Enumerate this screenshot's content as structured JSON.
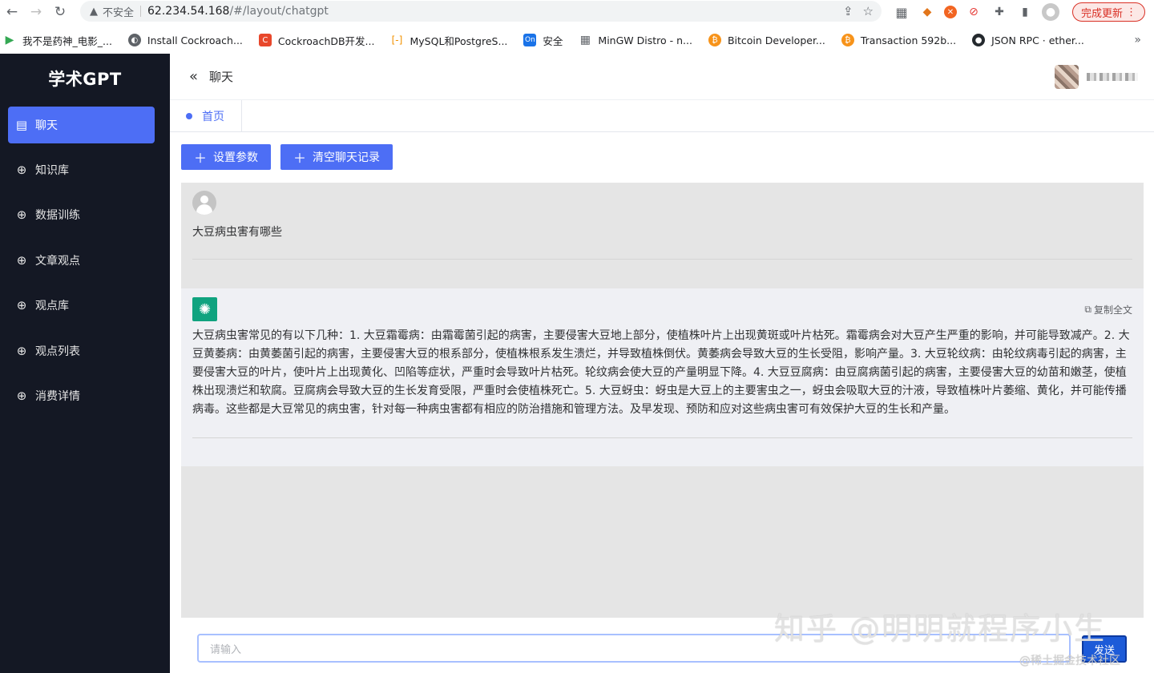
{
  "browser": {
    "insecure_label": "不安全",
    "url_host": "62.234.54.168",
    "url_path": "/#/layout/chatgpt",
    "update_label": "完成更新",
    "bookmarks": [
      "我不是药神_电影_...",
      "Install Cockroach...",
      "CockroachDB开发...",
      "MySQL和PostgreS...",
      "安全",
      "MinGW Distro - n...",
      "Bitcoin Developer...",
      "Transaction 592b...",
      "JSON RPC · ether..."
    ],
    "more_label": "»"
  },
  "sidebar": {
    "logo": "学术GPT",
    "items": [
      {
        "label": "聊天",
        "active": true
      },
      {
        "label": "知识库"
      },
      {
        "label": "数据训练"
      },
      {
        "label": "文章观点"
      },
      {
        "label": "观点库"
      },
      {
        "label": "观点列表"
      },
      {
        "label": "消费详情"
      }
    ]
  },
  "header": {
    "title": "聊天"
  },
  "tabs": [
    {
      "label": "首页"
    }
  ],
  "toolbar": {
    "set_params_label": "设置参数",
    "clear_history_label": "清空聊天记录"
  },
  "chat": {
    "user_message": "大豆病虫害有哪些",
    "copy_label": "复制全文",
    "ai_message": "大豆病虫害常见的有以下几种：1. 大豆霜霉病：由霜霉菌引起的病害，主要侵害大豆地上部分，使植株叶片上出现黄斑或叶片枯死。霜霉病会对大豆产生严重的影响，并可能导致减产。2. 大豆黄萎病：由黄萎菌引起的病害，主要侵害大豆的根系部分，使植株根系发生溃烂，并导致植株倒伏。黄萎病会导致大豆的生长受阻，影响产量。3. 大豆轮纹病：由轮纹病毒引起的病害，主要侵害大豆的叶片，使叶片上出现黄化、凹陷等症状，严重时会导致叶片枯死。轮纹病会使大豆的产量明显下降。4. 大豆豆腐病：由豆腐病菌引起的病害，主要侵害大豆的幼苗和嫩茎，使植株出现溃烂和软腐。豆腐病会导致大豆的生长发育受限，严重时会使植株死亡。5. 大豆蚜虫：蚜虫是大豆上的主要害虫之一，蚜虫会吸取大豆的汁液，导致植株叶片萎缩、黄化，并可能传播病毒。这些都是大豆常见的病虫害，针对每一种病虫害都有相应的防治措施和管理方法。及早发现、预防和应对这些病虫害可有效保护大豆的生长和产量。"
  },
  "input": {
    "placeholder": "请输入",
    "send_label": "发送"
  },
  "watermark": {
    "main": "知乎 @明明就程序小生",
    "secondary": "@稀土掘金技术社区"
  },
  "colors": {
    "sidebar_bg": "#141824",
    "accent": "#4d6ef5",
    "send_button": "#1d5bd8"
  }
}
